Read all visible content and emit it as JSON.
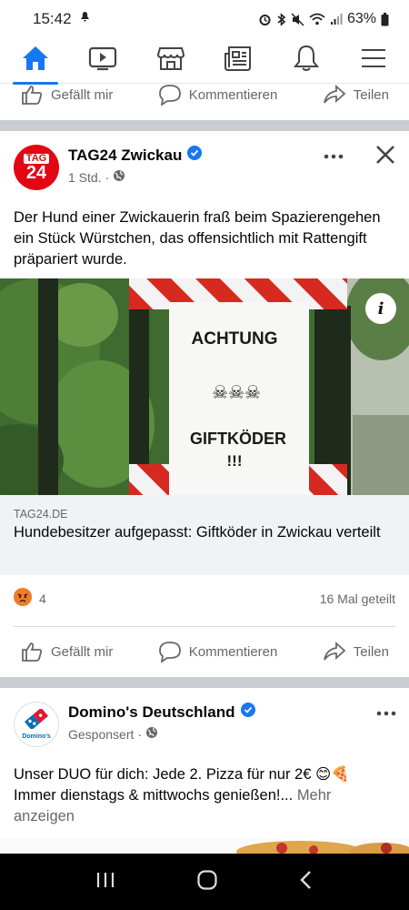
{
  "status": {
    "time": "15:42",
    "battery": "63%"
  },
  "nav": {
    "items": [
      "home-icon",
      "video-icon",
      "marketplace-icon",
      "news-icon",
      "notifications-icon",
      "menu-icon"
    ],
    "active": "home-icon"
  },
  "actions": {
    "like": "Gefällt mir",
    "comment": "Kommentieren",
    "share": "Teilen"
  },
  "post1": {
    "page_name": "TAG24 Zwickau",
    "avatar_text_top": "TAG",
    "avatar_text_bottom": "24",
    "time": "1 Std.",
    "text": "Der Hund einer Zwickauerin fraß beim Spazierengehen ein Stück Würstchen, das offensichtlich mit Rattengift präpariert wurde.",
    "image_sign": {
      "line1": "ACHTUNG",
      "line2": "GIFTKÖDER",
      "line3": "!!!"
    },
    "link_domain": "TAG24.DE",
    "link_title": "Hundebesitzer aufgepasst: Giftköder in Zwickau verteilt",
    "reaction_count": "4",
    "shares": "16 Mal geteilt"
  },
  "post2": {
    "page_name": "Domino's Deutschland",
    "avatar_label": "Domino's",
    "meta": "Gesponsert",
    "text": "Unser DUO für dich: Jede 2. Pizza für nur 2€ 😊🍕 Immer dienstags & mittwochs genießen!...",
    "see_more": "Mehr anzeigen"
  },
  "colors": {
    "brand": "#1877f2",
    "tag24_red": "#e30613",
    "separator": "#c9ccd1"
  }
}
